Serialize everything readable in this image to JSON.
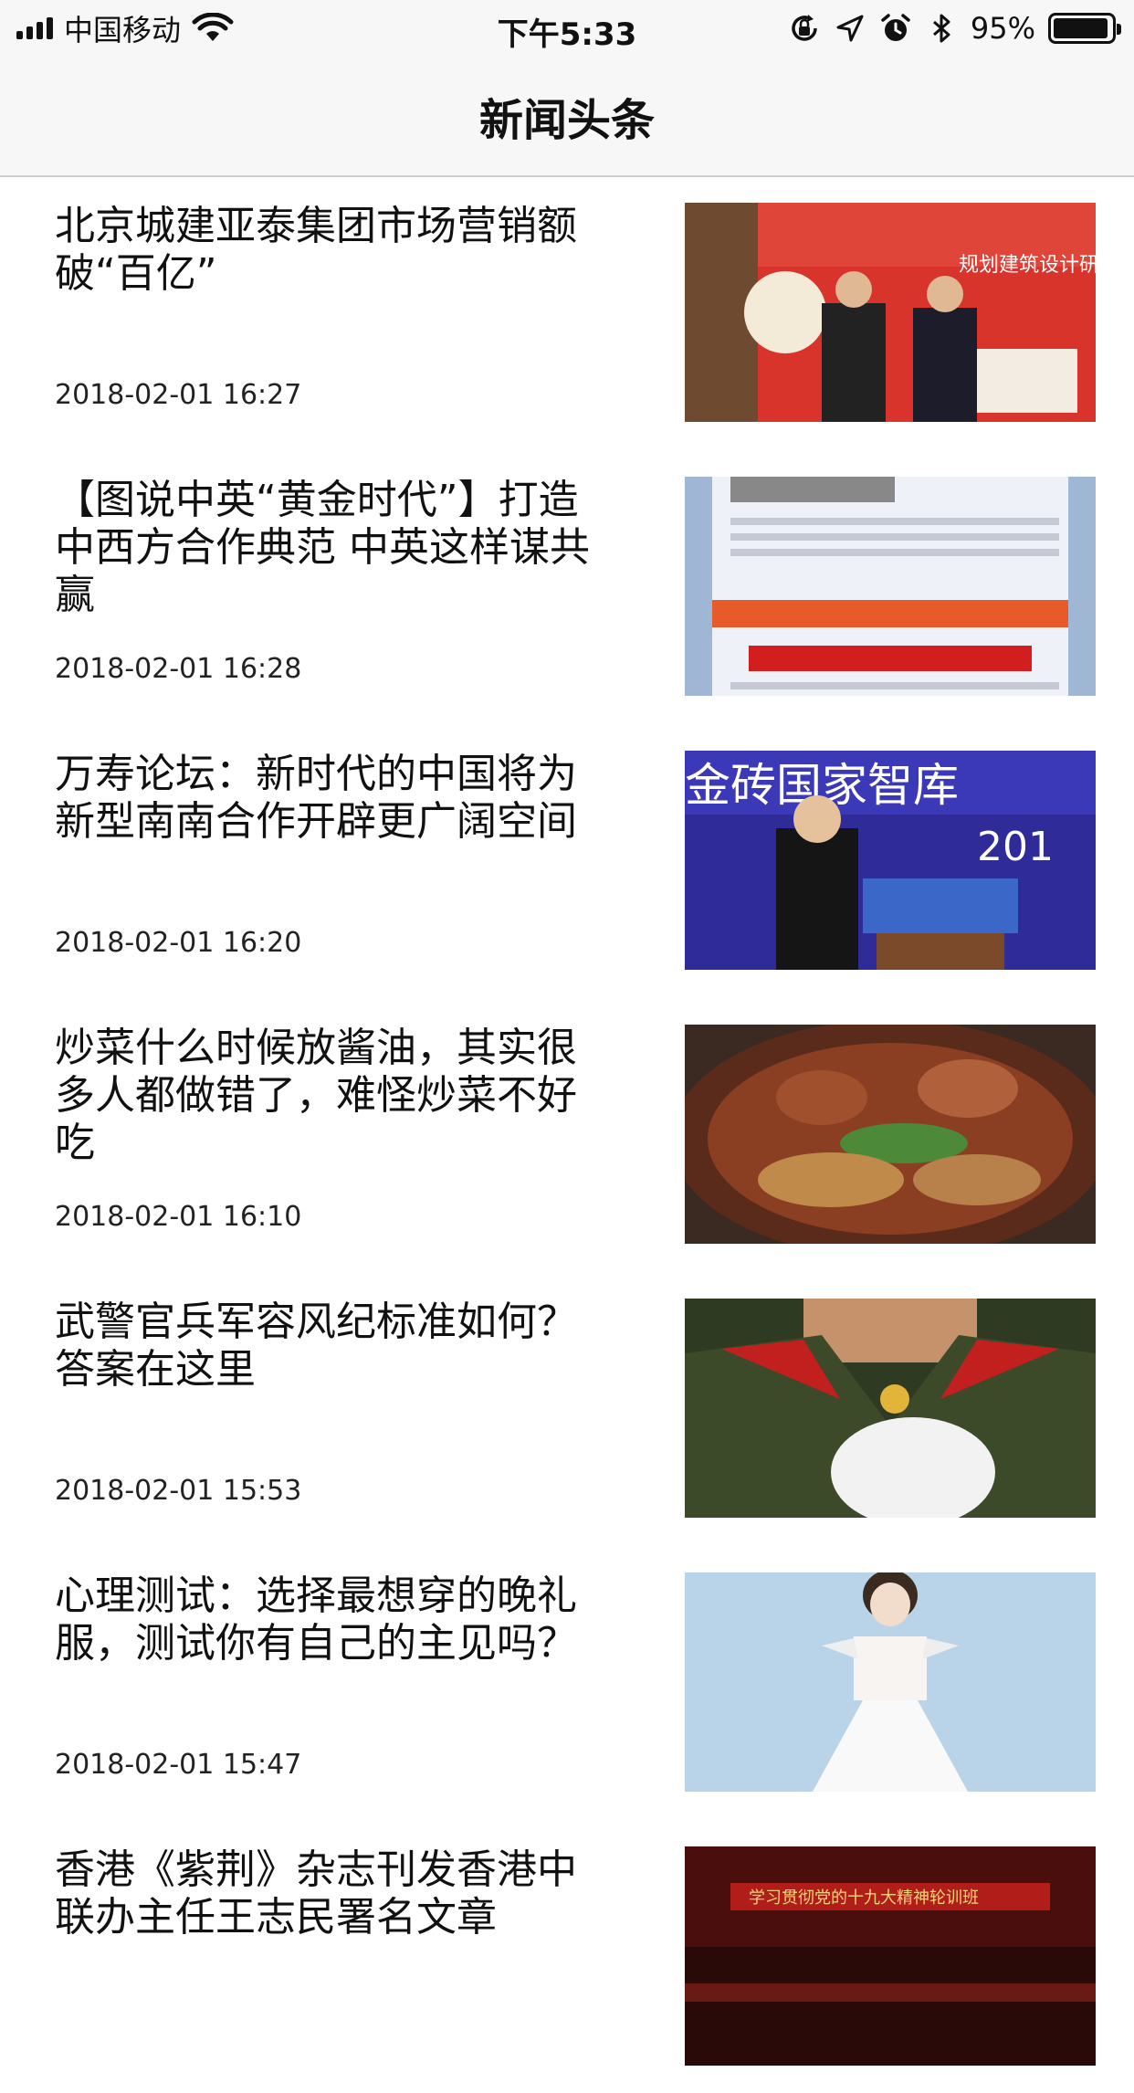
{
  "status_bar": {
    "carrier": "中国移动",
    "time": "下午5:33",
    "battery": "95%",
    "battery_level": 0.95
  },
  "nav": {
    "title": "新闻头条"
  },
  "news": [
    {
      "title": "北京城建亚泰集团市场营销额破“百亿”",
      "time": "2018-02-01 16:27",
      "thumb": "ceremony"
    },
    {
      "title": "【图说中英“黄金时代”】打造中西方合作典范 中英这样谋共赢",
      "time": "2018-02-01 16:28",
      "thumb": "infographic"
    },
    {
      "title": "万寿论坛：新时代的中国将为新型南南合作开辟更广阔空间",
      "time": "2018-02-01 16:20",
      "thumb": "forum"
    },
    {
      "title": "炒菜什么时候放酱油，其实很多人都做错了，难怪炒菜不好吃",
      "time": "2018-02-01 16:10",
      "thumb": "dish"
    },
    {
      "title": "武警官兵军容风纪标准如何？答案在这里",
      "time": "2018-02-01 15:53",
      "thumb": "uniform"
    },
    {
      "title": "心理测试：选择最想穿的晚礼服，测试你有自己的主见吗？",
      "time": "2018-02-01 15:47",
      "thumb": "dress"
    },
    {
      "title": "香港《紫荆》杂志刊发香港中联办主任王志民署名文章",
      "time": "",
      "thumb": "meeting"
    }
  ]
}
